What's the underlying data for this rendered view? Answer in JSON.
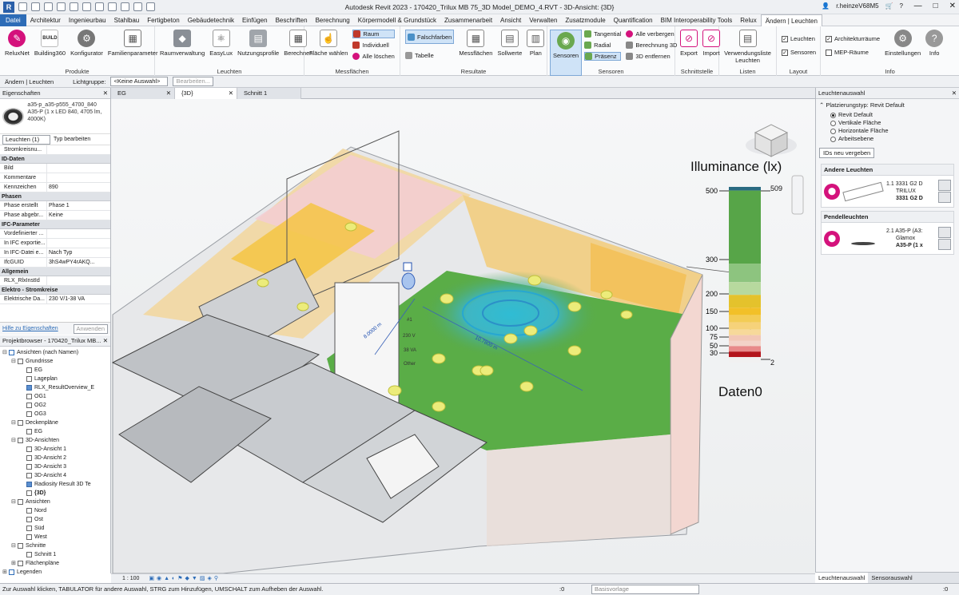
{
  "titlebar": {
    "logo": "R",
    "title": "Autodesk Revit 2023 - 170420_Trilux MB 75_3D Model_DEMO_4.RVT - 3D-Ansicht: {3D}",
    "user": "r.heinzeV68M5",
    "help": "?"
  },
  "menu": [
    "Datei",
    "Architektur",
    "Ingenieurbau",
    "Stahlbau",
    "Fertigbeton",
    "Gebäudetechnik",
    "Einfügen",
    "Beschriften",
    "Berechnung",
    "Körpermodell & Grundstück",
    "Zusammenarbeit",
    "Ansicht",
    "Verwalten",
    "Zusatzmodule",
    "Quantification",
    "BIM Interoperability Tools",
    "Relux",
    "Ändern | Leuchten"
  ],
  "ribbon": {
    "produkte": {
      "label": "Produkte",
      "buttons": [
        "ReluxNet",
        "Building360",
        "Konfigurator",
        "Familienparameter"
      ]
    },
    "leuchten": {
      "label": "Leuchten",
      "buttons": [
        "Raumverwaltung",
        "EasyLux",
        "Nutzungsprofile",
        "Berechnen"
      ]
    },
    "messflaechen": {
      "label": "Messflächen",
      "big": "Fläche wählen",
      "small": [
        "Raum",
        "Individuell",
        "Alle löschen"
      ]
    },
    "resultate": {
      "label": "Resultate",
      "small": [
        "Falschfarben",
        "Tabelle"
      ],
      "buttons": [
        "Messflächen",
        "Sollwerte",
        "Plan"
      ]
    },
    "sensoren": {
      "label": "Sensoren",
      "big": "Sensoren",
      "small": [
        "Tangential",
        "Radial",
        "Präsenz",
        "Alle verbergen",
        "Berechnung 3D",
        "3D entfernen"
      ]
    },
    "schnittstelle": {
      "label": "Schnittstelle",
      "buttons": [
        "Export",
        "Import"
      ]
    },
    "listen": {
      "label": "Listen",
      "buttons": [
        "Verwendungsliste Leuchten"
      ]
    },
    "layout": {
      "label": "Layout",
      "checks": [
        "Leuchten",
        "Sensoren"
      ]
    },
    "info": {
      "label": "Info",
      "checks": [
        "Architekturräume",
        "MEP-Räume"
      ],
      "buttons": [
        "Einstellungen",
        "Info"
      ]
    }
  },
  "optbar": {
    "context": "Ändern | Leuchten",
    "group_label": "Lichtgruppe:",
    "group_value": "<Keine Auswahl>",
    "edit": "Bearbeiten..."
  },
  "properties": {
    "title": "Eigenschaften",
    "type_name": "a35-p_a35-p555_4700_840",
    "type_desc": "A35-P (1 x LED 840, 4705 lm, 4000K)",
    "filter": "Leuchten (1)",
    "edit_type": "Typ bearbeiten",
    "rows": [
      {
        "sec": "",
        "k": "Stromkreisnu...",
        "v": ""
      },
      {
        "sec": "ID-Daten"
      },
      {
        "k": "Bild",
        "v": ""
      },
      {
        "k": "Kommentare",
        "v": ""
      },
      {
        "k": "Kennzeichen",
        "v": "890"
      },
      {
        "sec": "Phasen"
      },
      {
        "k": "Phase erstellt",
        "v": "Phase 1"
      },
      {
        "k": "Phase abgebr...",
        "v": "Keine"
      },
      {
        "sec": "IFC-Parameter"
      },
      {
        "k": "Vordefinierter ...",
        "v": ""
      },
      {
        "k": "In IFC exportie...",
        "v": ""
      },
      {
        "k": "In IFC-Datei e...",
        "v": "Nach Typ"
      },
      {
        "k": "IfcGUID",
        "v": "3hS4wPY4rAKQ..."
      },
      {
        "sec": "Allgemein"
      },
      {
        "k": "RLX_RlxInstId",
        "v": ""
      },
      {
        "sec": "Elektro - Stromkreise"
      },
      {
        "k": "Elektrische Da...",
        "v": "230 V/1-38 VA"
      }
    ],
    "help": "Hilfe zu Eigenschaften",
    "apply": "Anwenden"
  },
  "browser": {
    "title": "Projektbrowser - 170420_Trilux MB...",
    "nodes": [
      {
        "d": 0,
        "ex": "⊟",
        "t": "Ansichten (nach Namen)",
        "bx": false
      },
      {
        "d": 1,
        "ex": "⊟",
        "t": "Grundrisse"
      },
      {
        "d": 2,
        "t": "EG",
        "bx": true
      },
      {
        "d": 2,
        "t": "Lageplan",
        "bx": true
      },
      {
        "d": 2,
        "t": "RLX_ResultOverview_E",
        "bx": true,
        "fill": true
      },
      {
        "d": 2,
        "t": "OG1",
        "bx": true
      },
      {
        "d": 2,
        "t": "OG2",
        "bx": true
      },
      {
        "d": 2,
        "t": "OG3",
        "bx": true
      },
      {
        "d": 1,
        "ex": "⊟",
        "t": "Deckenpläne"
      },
      {
        "d": 2,
        "t": "EG",
        "bx": true
      },
      {
        "d": 1,
        "ex": "⊟",
        "t": "3D-Ansichten"
      },
      {
        "d": 2,
        "t": "3D-Ansicht 1",
        "bx": true
      },
      {
        "d": 2,
        "t": "3D-Ansicht 2",
        "bx": true
      },
      {
        "d": 2,
        "t": "3D-Ansicht 3",
        "bx": true
      },
      {
        "d": 2,
        "t": "3D-Ansicht 4",
        "bx": true
      },
      {
        "d": 2,
        "t": "Radiosity Result 3D Te",
        "bx": true,
        "fill": true
      },
      {
        "d": 2,
        "t": "{3D}",
        "bx": true,
        "bold": true
      },
      {
        "d": 1,
        "ex": "⊟",
        "t": "Ansichten"
      },
      {
        "d": 2,
        "t": "Nord",
        "bx": true
      },
      {
        "d": 2,
        "t": "Ost",
        "bx": true
      },
      {
        "d": 2,
        "t": "Süd",
        "bx": true
      },
      {
        "d": 2,
        "t": "West",
        "bx": true
      },
      {
        "d": 1,
        "ex": "⊟",
        "t": "Schnitte"
      },
      {
        "d": 2,
        "t": "Schnitt 1",
        "bx": true
      },
      {
        "d": 1,
        "ex": "⊞",
        "t": "Flächenpläne"
      },
      {
        "d": 0,
        "ex": "⊞",
        "t": "Legenden",
        "bx": false
      }
    ]
  },
  "viewtabs": [
    "EG",
    "{3D}",
    "Schnitt 1"
  ],
  "viewport": {
    "legend_title": "Illuminance (lx)",
    "legend_ticks": [
      "500",
      "300",
      "200",
      "150",
      "100",
      "75",
      "50",
      "30"
    ],
    "legend_max": "509",
    "legend_min": "2",
    "legend_colors": [
      "#2a6b82",
      "#57a548",
      "#5aa84a",
      "#8dc47f",
      "#b7d99e",
      "#e4c22c",
      "#f2c028",
      "#f3cc55",
      "#f6d27a",
      "#f7d99a",
      "#f2c7b6",
      "#f3d3c8",
      "#e88a8a",
      "#b3151c",
      "#f1f1f1"
    ],
    "data_label": "Daten0",
    "dim1": "8.0000 m",
    "dim2": "10.7800 m",
    "tag1": "#1",
    "tag2": "230 V",
    "tag3": "38 VA",
    "tag4": "Other"
  },
  "viewctrl": {
    "scale": "1 : 100"
  },
  "rpanel": {
    "title": "Leuchtenauswahl",
    "placement": "Platzierungstyp: Revit Default",
    "options": [
      "Revit Default",
      "Vertikale Fläche",
      "Horizontale Fläche",
      "Arbeitsebene"
    ],
    "renumber": "IDs neu vergeben",
    "groups": [
      {
        "name": "Andere Leuchten",
        "num": "1.1",
        "l1": "3331 G2 D",
        "l2": "TRILUX",
        "l3": "3331 G2 D"
      },
      {
        "name": "Pendelleuchten",
        "num": "2.1",
        "l1": "A35-P (A3:",
        "l2": "Glamox",
        "l3": "A35-P (1 x"
      }
    ],
    "tabs": [
      "Leuchtenauswahl",
      "Sensorauswahl"
    ]
  },
  "status": {
    "text": "Zur Auswahl klicken, TABULATOR für andere Auswahl, STRG zum Hinzufügen, UMSCHALT zum Aufheben der Auswahl.",
    "zero": ":0",
    "template": "Basisvorlage",
    "filter_count": ":0"
  }
}
